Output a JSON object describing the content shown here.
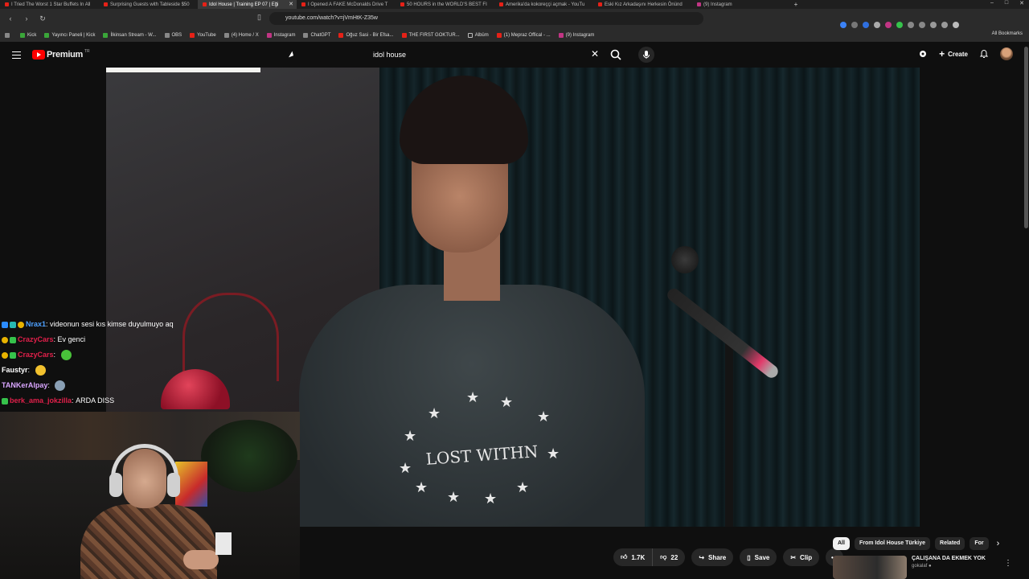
{
  "browser": {
    "tabs": [
      {
        "title": "I Tried The Worst 1 Star Buffets In All",
        "active": false
      },
      {
        "title": "Surprising Guests with Tableside $50",
        "active": false
      },
      {
        "title": "Idol House | Training EP 07 | Eği",
        "active": true
      },
      {
        "title": "I Opened A FAKE McDonalds Drive T",
        "active": false
      },
      {
        "title": "50 HOURS in the WORLD'S BEST FI",
        "active": false
      },
      {
        "title": "Amerika'da kokoreççi açmak - YouTu",
        "active": false
      },
      {
        "title": "Eski Kız Arkadaşını Herkesin Önünd",
        "active": false
      },
      {
        "title": "(9) Instagram",
        "active": false
      }
    ],
    "url": "youtube.com/watch?v=jVmHtK-Z35w",
    "bookmarks": [
      {
        "label": "Kick",
        "icon": "kick-icon"
      },
      {
        "label": "Yayıncı Paneli | Kick",
        "icon": "kick-icon"
      },
      {
        "label": "İlkinsan Stream - W...",
        "icon": "kick-icon"
      },
      {
        "label": "OBS",
        "icon": "obs-icon"
      },
      {
        "label": "YouTube",
        "icon": "youtube-icon"
      },
      {
        "label": "(4) Home / X",
        "icon": "x-icon"
      },
      {
        "label": "Instagram",
        "icon": "instagram-icon"
      },
      {
        "label": "ChatGPT",
        "icon": "chatgpt-icon"
      },
      {
        "label": "Oğuz Sasi - Bir Efsa...",
        "icon": "youtube-icon"
      },
      {
        "label": "THE FIRST GOKTUR...",
        "icon": "youtube-icon"
      },
      {
        "label": "Albüm",
        "icon": "folder-icon"
      },
      {
        "label": "(1) Mepraz Offical - ...",
        "icon": "youtube-icon"
      },
      {
        "label": "(9) Instagram",
        "icon": "instagram-icon"
      }
    ],
    "all_bookmarks": "All Bookmarks"
  },
  "youtube": {
    "logo": "Premium",
    "logo_region": "TR",
    "search_value": "idol house",
    "create_label": "Create"
  },
  "chat": [
    {
      "badges": [
        "b-blue",
        "b-teal",
        "b-yellow"
      ],
      "user": "Nrax1",
      "user_color": "#4ea1ff",
      "message": "videonun sesi kıs kimse duyulmuyo aq",
      "emote": ""
    },
    {
      "badges": [
        "b-yellow",
        "b-green"
      ],
      "user": "CrazyCars",
      "user_color": "#e0204a",
      "message": "Ev genci",
      "emote": ""
    },
    {
      "badges": [
        "b-yellow",
        "b-green"
      ],
      "user": "CrazyCars",
      "user_color": "#e0204a",
      "message": "",
      "emote": "#49c23a"
    },
    {
      "badges": [],
      "user": "Faustyr",
      "user_color": "#ffffff",
      "message": "",
      "emote": "#f2c12e"
    },
    {
      "badges": [],
      "user": "TANKerAlpay",
      "user_color": "#d9a6ff",
      "message": "",
      "emote": "#8aa0b5"
    },
    {
      "badges": [
        "b-green"
      ],
      "user": "berk_ama_jokzilla",
      "user_color": "#e0204a",
      "message": "ARDA DISS",
      "emote": ""
    }
  ],
  "actions": {
    "like_count": "1.7K",
    "dislike_count": "22",
    "share": "Share",
    "save": "Save",
    "clip": "Clip"
  },
  "chips": [
    "All",
    "From Idol House Türkiye",
    "Related",
    "For"
  ],
  "recommendation": {
    "title": "ÇALIŞANA DA EKMEK YOK",
    "channel": "gokalaf"
  },
  "video": {
    "shirt_text": "LOST WITHN"
  }
}
